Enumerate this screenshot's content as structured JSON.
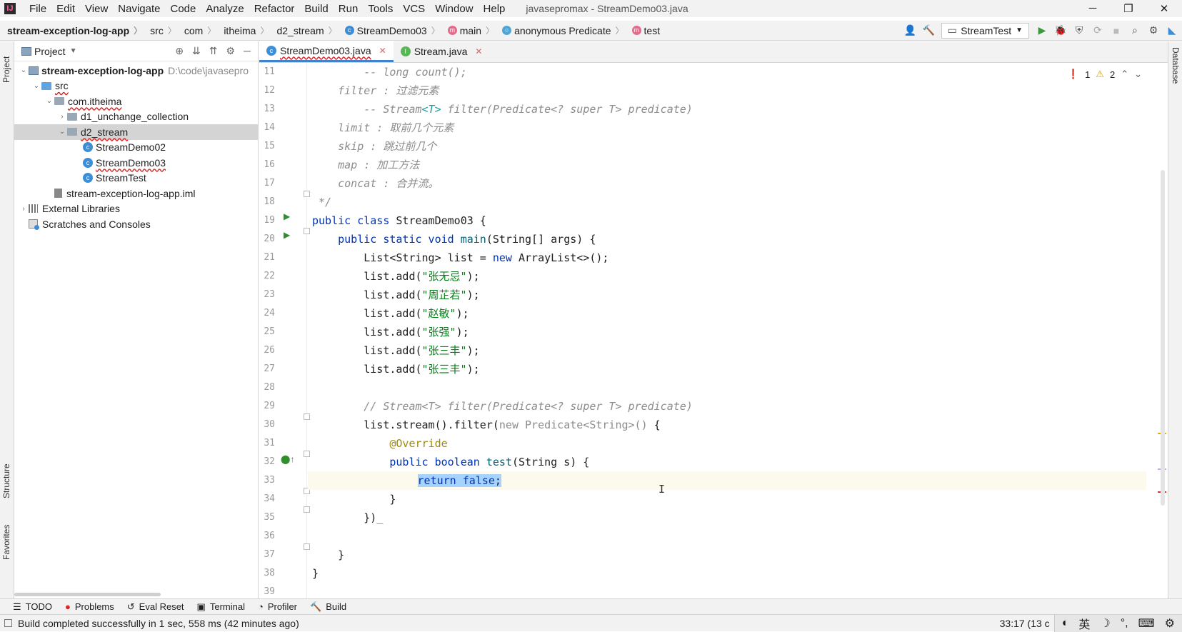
{
  "menubar": {
    "items": [
      "File",
      "Edit",
      "View",
      "Navigate",
      "Code",
      "Analyze",
      "Refactor",
      "Build",
      "Run",
      "Tools",
      "VCS",
      "Window",
      "Help"
    ],
    "window_title": "javasepromax - StreamDemo03.java"
  },
  "navbar": {
    "crumbs": [
      "stream-exception-log-app",
      "src",
      "com",
      "itheima",
      "d2_stream",
      "StreamDemo03",
      "main",
      "anonymous Predicate",
      "test"
    ],
    "run_config": "StreamTest"
  },
  "stripes": {
    "project": "Project",
    "structure": "Structure",
    "favorites": "Favorites",
    "database": "Database"
  },
  "project": {
    "title": "Project",
    "tree": [
      {
        "label": "stream-exception-log-app",
        "path": "D:\\code\\javasepro",
        "depth": 0
      },
      {
        "label": "src",
        "depth": 1
      },
      {
        "label": "com.itheima",
        "depth": 2
      },
      {
        "label": "d1_unchange_collection",
        "depth": 3
      },
      {
        "label": "d2_stream",
        "depth": 3
      },
      {
        "label": "StreamDemo02",
        "depth": 4
      },
      {
        "label": "StreamDemo03",
        "depth": 4
      },
      {
        "label": "StreamTest",
        "depth": 4
      },
      {
        "label": "stream-exception-log-app.iml",
        "depth": 2
      },
      {
        "label": "External Libraries",
        "depth": 0
      },
      {
        "label": "Scratches and Consoles",
        "depth": 0
      }
    ]
  },
  "editor": {
    "tabs": [
      "StreamDemo03.java",
      "Stream.java"
    ],
    "inspections": {
      "errors": "1",
      "warnings": "2"
    },
    "line_numbers": [
      "11",
      "12",
      "13",
      "14",
      "15",
      "16",
      "17",
      "18",
      "19",
      "20",
      "21",
      "22",
      "23",
      "24",
      "25",
      "26",
      "27",
      "28",
      "29",
      "30",
      "31",
      "32",
      "33",
      "34",
      "35",
      "36",
      "37",
      "38",
      "39"
    ]
  },
  "bottom_tools": [
    "TODO",
    "Problems",
    "Eval Reset",
    "Terminal",
    "Profiler",
    "Build"
  ],
  "status": {
    "message": "Build completed successfully in 1 sec, 558 ms (42 minutes ago)",
    "position": "33:17 (13 c",
    "ime_lang": "英"
  }
}
